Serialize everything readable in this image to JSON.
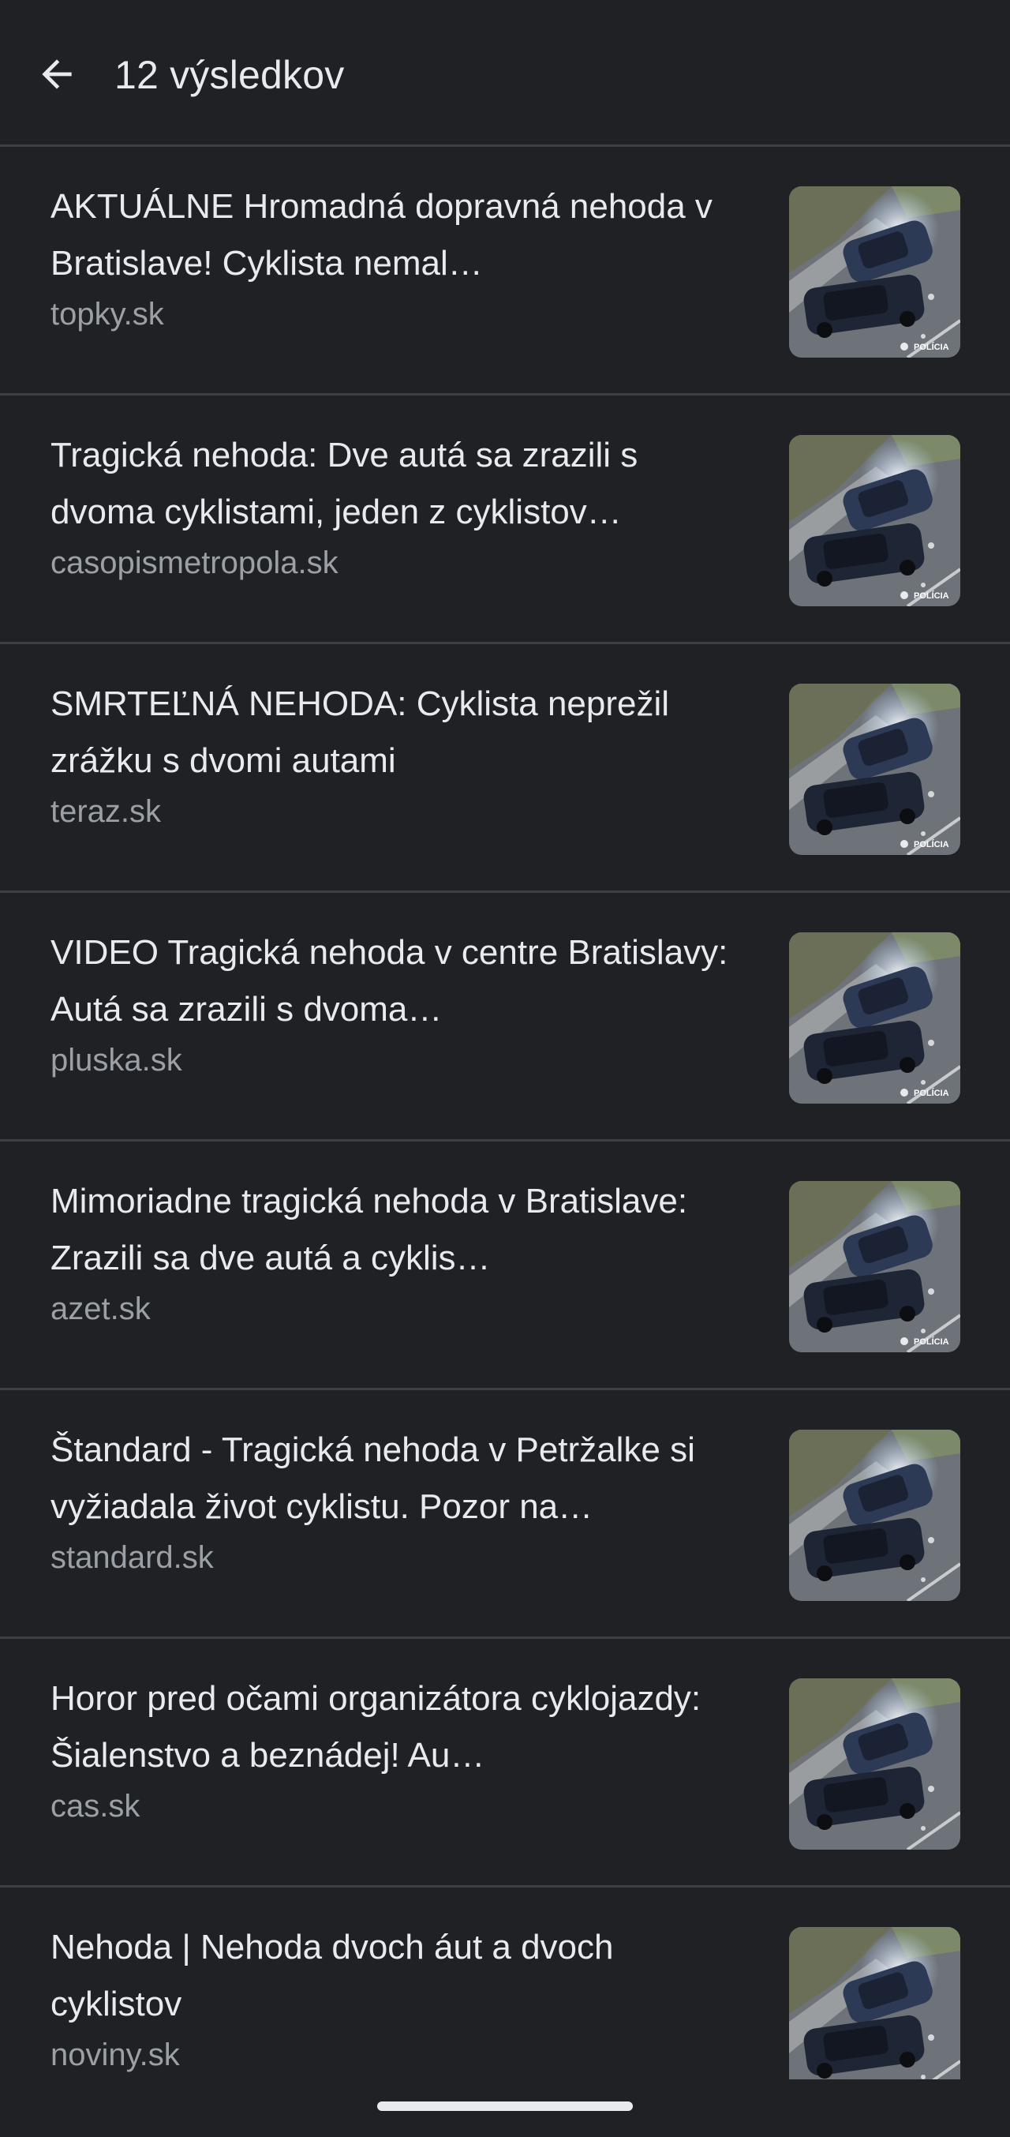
{
  "header": {
    "back_icon": "arrow-back-icon",
    "title": "12 výsledkov"
  },
  "results": [
    {
      "title": "AKTUÁLNE Hromadná dopravná nehoda v Bratislave! Cyklista nemal…",
      "source": "topky.sk",
      "thumb_badge": "POLÍCIA"
    },
    {
      "title": "Tragická nehoda: Dve autá sa zrazili s dvoma cyklistami, jeden z cyklistov…",
      "source": "casopismetropola.sk",
      "thumb_badge": "POLÍCIA"
    },
    {
      "title": "SMRTEĽNÁ NEHODA: Cyklista neprežil zrážku s dvomi autami",
      "source": "teraz.sk",
      "thumb_badge": "POLÍCIA"
    },
    {
      "title": "VIDEO Tragická nehoda v centre Bratislavy: Autá sa zrazili s dvoma…",
      "source": "pluska.sk",
      "thumb_badge": "POLÍCIA"
    },
    {
      "title": "Mimoriadne tragická nehoda v Bratislave: Zrazili sa dve autá a cyklis…",
      "source": "azet.sk",
      "thumb_badge": "POLÍCIA"
    },
    {
      "title": "Štandard - Tragická nehoda v Petržalke si vyžiadala život cyklistu. Pozor na…",
      "source": "standard.sk",
      "thumb_badge": ""
    },
    {
      "title": "Horor pred očami organizátora cyklojazdy: Šialenstvo a beznádej! Au…",
      "source": "cas.sk",
      "thumb_badge": ""
    },
    {
      "title": "Nehoda | Nehoda dvoch áut a dvoch cyklistov",
      "source": "noviny.sk",
      "thumb_badge": ""
    }
  ],
  "colors": {
    "background": "#202124",
    "divider": "#3c4043",
    "title_text": "#e8eaed",
    "source_text": "#9aa0a6"
  }
}
